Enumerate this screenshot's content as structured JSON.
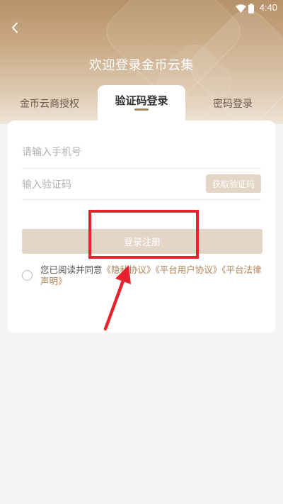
{
  "status_bar": {
    "time": "4:40"
  },
  "header": {
    "title": "欢迎登录金币云集"
  },
  "tabs": [
    {
      "label": "金币云商授权"
    },
    {
      "label": "验证码登录"
    },
    {
      "label": "密码登录"
    }
  ],
  "form": {
    "phone_placeholder": "请输入手机号",
    "code_placeholder": "输入验证码",
    "get_code_label": "获取验证码",
    "submit_label": "登录注册"
  },
  "agreement": {
    "prefix": "您已阅读并同意",
    "privacy_link": "《隐私协议》",
    "user_link": "《平台用户协议》",
    "legal_link": "《平台法律声明》"
  },
  "colors": {
    "accent": "#b08356",
    "button_disabled": "#e3d6c6",
    "annotation": "#e8222d"
  }
}
